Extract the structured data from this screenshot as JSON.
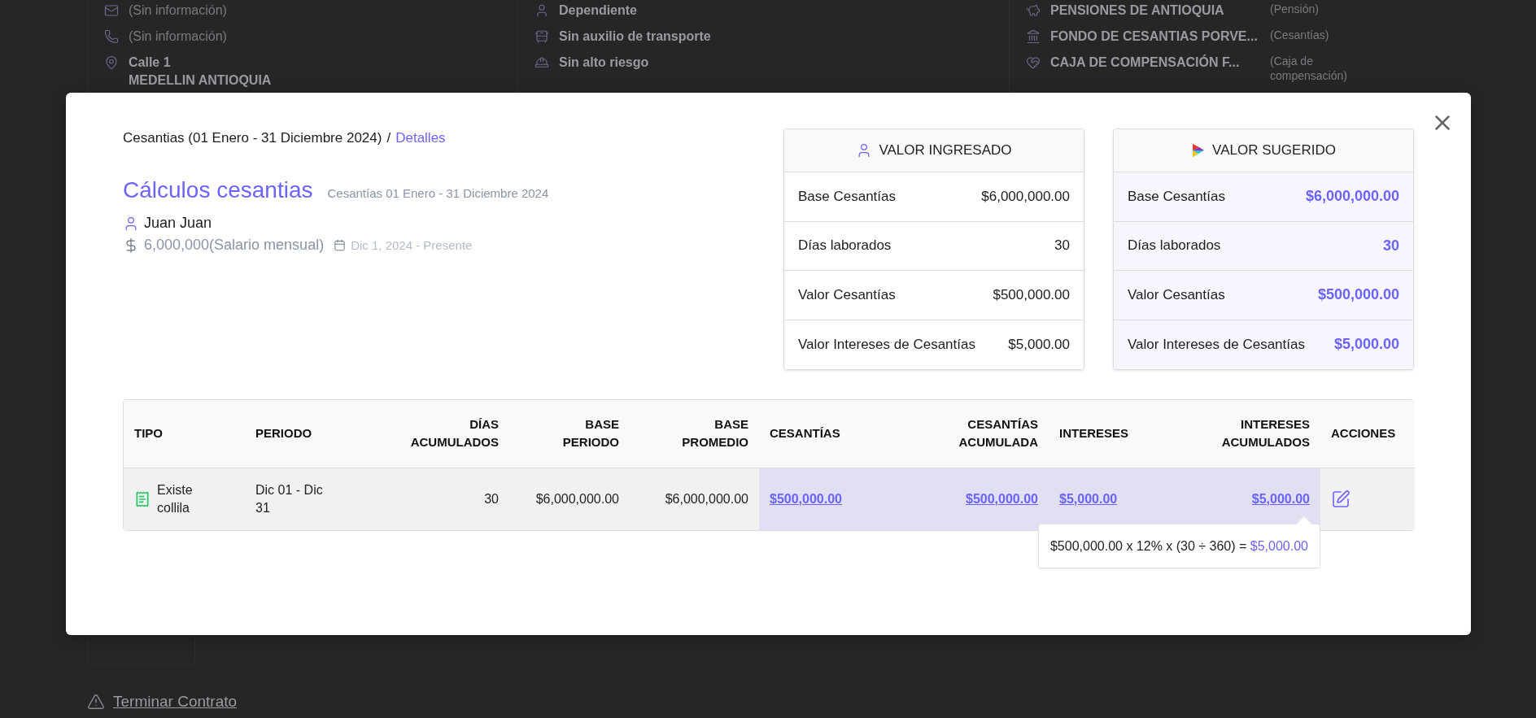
{
  "background": {
    "contact": [
      {
        "kind": "email",
        "lines": [
          "(Sin información)"
        ]
      },
      {
        "kind": "phone",
        "lines": [
          "(Sin información)"
        ]
      },
      {
        "kind": "address",
        "lines": [
          "Calle 1",
          "MEDELLIN ANTIOQUIA"
        ]
      }
    ],
    "contract": [
      {
        "kind": "worker",
        "text": "Dependiente"
      },
      {
        "kind": "transport",
        "text": "Sin auxilio de transporte"
      },
      {
        "kind": "risk",
        "text": "Sin alto riesgo"
      }
    ],
    "entities": [
      {
        "kind": "pension",
        "name": "PENSIONES DE ANTIOQUIA",
        "type": "(Pensión)"
      },
      {
        "kind": "severance",
        "name": "FONDO DE CESANTIAS PORVE...",
        "type": "(Cesantías)"
      },
      {
        "kind": "compensation",
        "name": "CAJA DE COMPENSACIÓN F...",
        "type": "(Caja de compensación)"
      }
    ],
    "terminate_link": "Terminar Contrato"
  },
  "modal": {
    "breadcrumb": {
      "parent": "Cesantias (01 Enero - 31 Diciembre 2024)",
      "separator": "/",
      "current": "Detalles"
    },
    "title": "Cálculos cesantias",
    "subtitle": "Cesantías 01 Enero - 31 Diciembre 2024",
    "employee": "Juan Juan",
    "salary": "6,000,000(Salario mensual)",
    "dates": "Dic 1, 2024 - Presente",
    "cards": [
      {
        "kind": "entered",
        "title": "VALOR INGRESADO",
        "rows": [
          {
            "label": "Base Cesantías",
            "value": "$6,000,000.00"
          },
          {
            "label": "Días laborados",
            "value": "30"
          },
          {
            "label": "Valor Cesantías",
            "value": "$500,000.00"
          },
          {
            "label": "Valor Intereses de Cesantías",
            "value": "$5,000.00"
          }
        ]
      },
      {
        "kind": "suggested",
        "title": "VALOR SUGERIDO",
        "rows": [
          {
            "label": "Base Cesantías",
            "value": "$6,000,000.00"
          },
          {
            "label": "Días laborados",
            "value": "30"
          },
          {
            "label": "Valor Cesantías",
            "value": "$500,000.00"
          },
          {
            "label": "Valor Intereses de Cesantías",
            "value": "$5,000.00"
          }
        ]
      }
    ],
    "table": {
      "columns": [
        "TIPO",
        "PERIODO",
        "DÍAS ACUMULADOS",
        "BASE PERIODO",
        "BASE PROMEDIO",
        "CESANTÍAS",
        "CESANTÍAS ACUMULADA",
        "INTERESES",
        "INTERESES ACUMULADOS",
        "ACCIONES"
      ],
      "rows": [
        {
          "kind": "payslip",
          "tipo": "Existe collila",
          "periodo": "Dic 01 - Dic 31",
          "dias": "30",
          "base_periodo": "$6,000,000.00",
          "base_promedio": "$6,000,000.00",
          "cesantias": "$500,000.00",
          "cesantias_acumulada": "$500,000.00",
          "intereses": "$5,000.00",
          "intereses_acumulados": "$5,000.00"
        }
      ]
    },
    "tooltip": {
      "formula": "$500,000.00 x 12% x (30 ÷ 360) =",
      "result": "$5,000.00"
    }
  }
}
